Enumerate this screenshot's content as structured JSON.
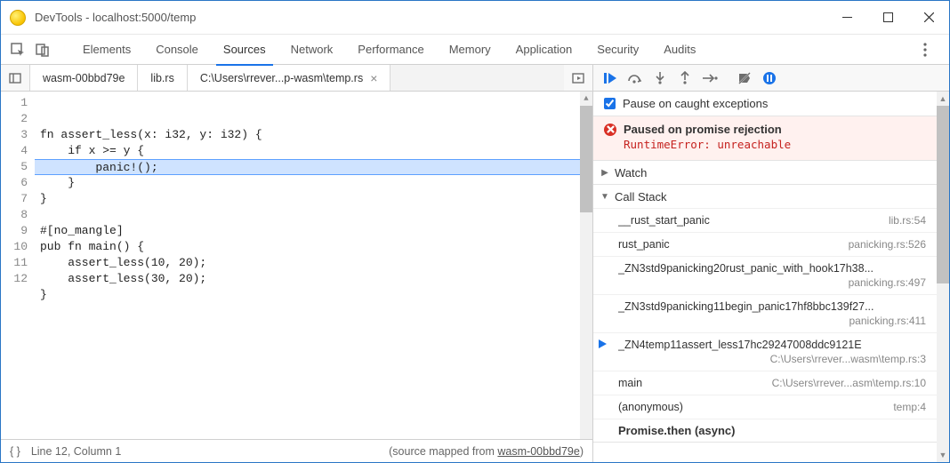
{
  "window": {
    "title": "DevTools - localhost:5000/temp"
  },
  "tabs": {
    "items": [
      "Elements",
      "Console",
      "Sources",
      "Network",
      "Performance",
      "Memory",
      "Application",
      "Security",
      "Audits"
    ],
    "active": "Sources"
  },
  "fileTabs": {
    "items": [
      "wasm-00bbd79e",
      "lib.rs",
      "C:\\Users\\rrever...p-wasm\\temp.rs"
    ],
    "active": 2
  },
  "editor": {
    "highlighted_line": 3,
    "lines": [
      "fn assert_less(x: i32, y: i32) {",
      "    if x >= y {",
      "        panic!();",
      "    }",
      "}",
      "",
      "#[no_mangle]",
      "pub fn main() {",
      "    assert_less(10, 20);",
      "    assert_less(30, 20);",
      "}",
      ""
    ]
  },
  "status": {
    "position": "Line 12, Column 1",
    "mapped_prefix": "(source mapped from ",
    "mapped_link": "wasm-00bbd79e",
    "mapped_suffix": ")"
  },
  "debugger": {
    "pause_caught_label": "Pause on caught exceptions",
    "paused_title": "Paused on promise rejection",
    "paused_message": "RuntimeError: unreachable",
    "watch_label": "Watch",
    "callstack_label": "Call Stack",
    "stack": [
      {
        "name": "__rust_start_panic",
        "loc": "lib.rs:54"
      },
      {
        "name": "rust_panic",
        "loc": "panicking.rs:526"
      },
      {
        "name": "_ZN3std9panicking20rust_panic_with_hook17h38...",
        "loc": "panicking.rs:497",
        "double": true
      },
      {
        "name": "_ZN3std9panicking11begin_panic17hf8bbc139f27...",
        "loc": "panicking.rs:411",
        "double": true
      },
      {
        "name": "_ZN4temp11assert_less17hc29247008ddc9121E",
        "loc": "C:\\Users\\rrever...wasm\\temp.rs:3",
        "double": true,
        "current": true
      },
      {
        "name": "main",
        "loc": "C:\\Users\\rrever...asm\\temp.rs:10"
      },
      {
        "name": "(anonymous)",
        "loc": "temp:4"
      }
    ],
    "async_label": "Promise.then (async)"
  }
}
